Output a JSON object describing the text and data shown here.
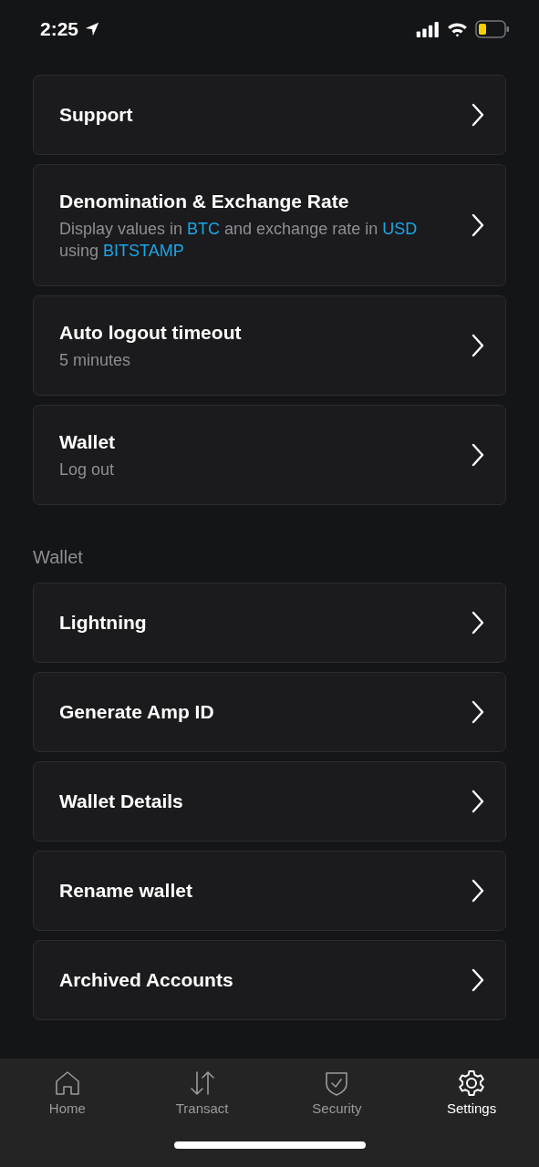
{
  "status_bar": {
    "time": "2:25"
  },
  "sections": [
    {
      "items": [
        {
          "title": "Support"
        },
        {
          "title": "Denomination & Exchange Rate",
          "subtitle_parts": [
            {
              "text": "Display values in ",
              "highlight": false
            },
            {
              "text": "BTC",
              "highlight": true
            },
            {
              "text": " and exchange rate in ",
              "highlight": false
            },
            {
              "text": "USD",
              "highlight": true
            },
            {
              "text": " using ",
              "highlight": false
            },
            {
              "text": "BITSTAMP",
              "highlight": true
            }
          ]
        },
        {
          "title": "Auto logout timeout",
          "subtitle_parts": [
            {
              "text": "5 minutes",
              "highlight": false
            }
          ]
        },
        {
          "title": "Wallet",
          "subtitle_parts": [
            {
              "text": "Log out",
              "highlight": false
            }
          ]
        }
      ]
    },
    {
      "header": "Wallet",
      "items": [
        {
          "title": "Lightning"
        },
        {
          "title": "Generate Amp ID"
        },
        {
          "title": "Wallet Details"
        },
        {
          "title": "Rename wallet"
        },
        {
          "title": "Archived Accounts"
        }
      ]
    }
  ],
  "tab_bar": [
    {
      "kind": "home",
      "label": "Home",
      "selected": false
    },
    {
      "kind": "transact",
      "label": "Transact",
      "selected": false
    },
    {
      "kind": "security",
      "label": "Security",
      "selected": false
    },
    {
      "kind": "settings",
      "label": "Settings",
      "selected": true
    }
  ]
}
